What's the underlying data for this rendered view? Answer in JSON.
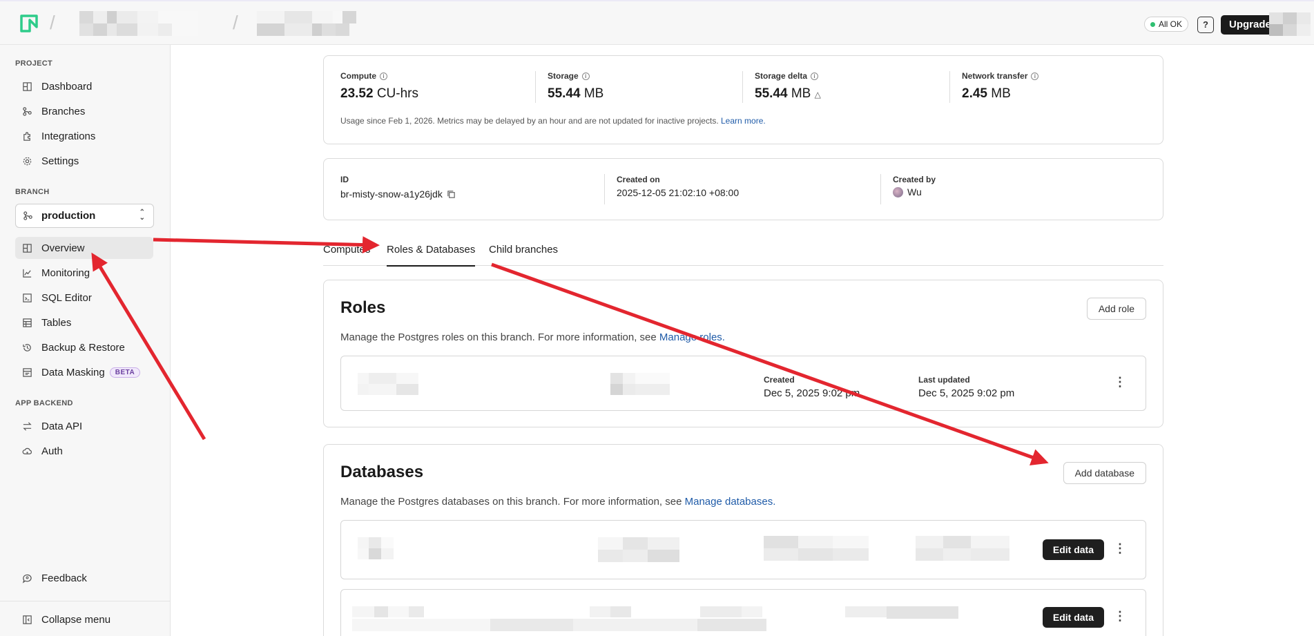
{
  "header": {
    "status_label": "All OK",
    "help_label": "?",
    "upgrade_label": "Upgrade"
  },
  "sidebar": {
    "project_title": "PROJECT",
    "project_items": [
      "Dashboard",
      "Branches",
      "Integrations",
      "Settings"
    ],
    "branch_title": "BRANCH",
    "branch_value": "production",
    "branch_items": [
      "Overview",
      "Monitoring",
      "SQL Editor",
      "Tables",
      "Backup & Restore",
      "Data Masking"
    ],
    "beta_badge": "BETA",
    "app_backend_title": "APP BACKEND",
    "app_backend_items": [
      "Data API",
      "Auth"
    ],
    "feedback": "Feedback",
    "collapse": "Collapse menu"
  },
  "usage": {
    "compute_label": "Compute",
    "compute_value": "23.52",
    "compute_unit": "CU-hrs",
    "storage_label": "Storage",
    "storage_value": "55.44",
    "storage_unit": "MB",
    "delta_label": "Storage delta",
    "delta_value": "55.44",
    "delta_unit": "MB",
    "network_label": "Network transfer",
    "network_value": "2.45",
    "network_unit": "MB",
    "note": "Usage since Feb 1, 2026. Metrics may be delayed by an hour and are not updated for inactive projects.",
    "note_link": "Learn more."
  },
  "branch_info": {
    "id_label": "ID",
    "id_value": "br-misty-snow-a1y26jdk",
    "created_on_label": "Created on",
    "created_on_value": "2025-12-05 21:02:10 +08:00",
    "created_by_label": "Created by",
    "created_by_value": "Wu"
  },
  "tabs": [
    "Computes",
    "Roles & Databases",
    "Child branches"
  ],
  "roles": {
    "title": "Roles",
    "add_label": "Add role",
    "desc": "Manage the Postgres roles on this branch. For more information, see",
    "desc_link": "Manage roles.",
    "created_label": "Created",
    "created_value": "Dec 5, 2025 9:02 pm",
    "updated_label": "Last updated",
    "updated_value": "Dec 5, 2025 9:02 pm"
  },
  "databases": {
    "title": "Databases",
    "add_label": "Add database",
    "desc": "Manage the Postgres databases on this branch. For more information, see",
    "desc_link": "Manage databases.",
    "edit_label": "Edit data"
  },
  "colors": {
    "accent_link": "#1f5ba8",
    "status_ok": "#2fbf71",
    "annotation_arrow": "#e3262f",
    "logo": "#2ecc8a"
  }
}
